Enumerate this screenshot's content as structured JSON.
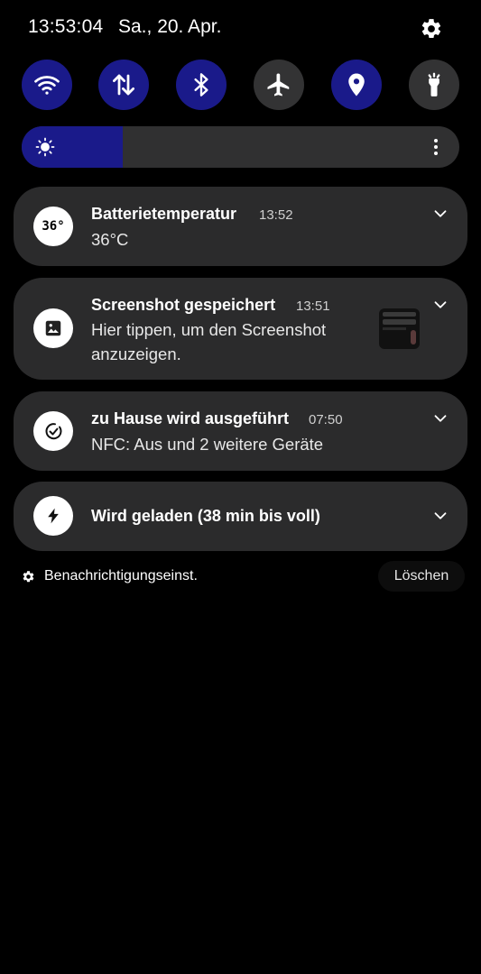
{
  "header": {
    "time": "13:53:04",
    "date": "Sa., 20. Apr."
  },
  "quick_settings": [
    {
      "name": "wifi",
      "icon": "wifi-icon",
      "state": "on"
    },
    {
      "name": "mobile-data",
      "icon": "data-transfer-icon",
      "state": "on"
    },
    {
      "name": "bluetooth",
      "icon": "bluetooth-icon",
      "state": "on"
    },
    {
      "name": "airplane-mode",
      "icon": "airplane-icon",
      "state": "off"
    },
    {
      "name": "location",
      "icon": "location-pin-icon",
      "state": "on"
    },
    {
      "name": "flashlight",
      "icon": "flashlight-icon",
      "state": "off"
    }
  ],
  "brightness": {
    "level": 0.23
  },
  "notifications": [
    {
      "icon": "thermometer-36-icon",
      "icon_text": "36°",
      "title": "Batterietemperatur",
      "time": "13:52",
      "body": "36°C"
    },
    {
      "icon": "image-icon",
      "title": "Screenshot gespeichert",
      "time": "13:51",
      "body": "Hier tippen, um den Screenshot anzuzeigen."
    },
    {
      "icon": "routine-check-icon",
      "title": "zu Hause wird ausgeführt",
      "time": "07:50",
      "body": "NFC: Aus und 2 weitere Geräte"
    },
    {
      "icon": "lightning-bolt-icon",
      "title": "Wird geladen (38 min bis voll)"
    }
  ],
  "footer": {
    "settings_label": "Benachrichtigungseinst.",
    "clear_label": "Löschen"
  },
  "colors": {
    "accent": "#1a1a8a",
    "card_bg": "#2b2b2c",
    "background": "#000000"
  }
}
